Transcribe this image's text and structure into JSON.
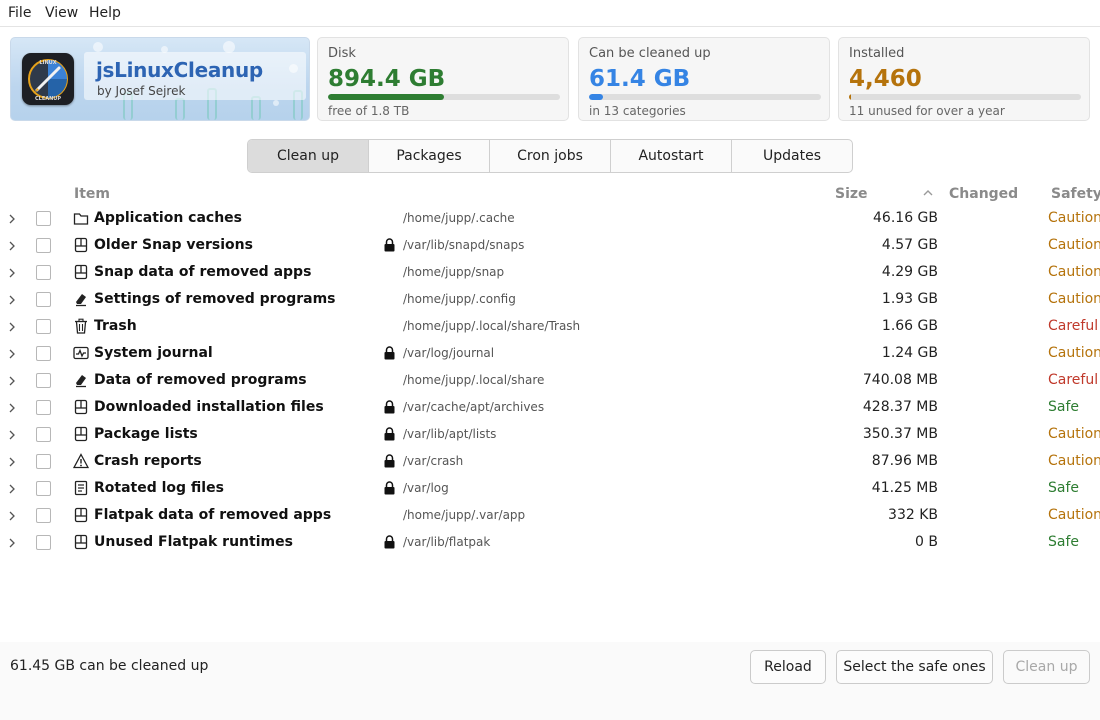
{
  "menu": [
    "File",
    "View",
    "Help"
  ],
  "app": {
    "name": "jsLinuxCleanup",
    "author": "by Josef Sejrek",
    "icon_text_top": "LINUX",
    "icon_text_bottom": "CLEANUP"
  },
  "cards": [
    {
      "title": "Disk",
      "value": "894.4 GB",
      "sub": "free of 1.8 TB",
      "color": "#2e7d32",
      "fill_fraction": 0.5
    },
    {
      "title": "Can be cleaned up",
      "value": "61.4 GB",
      "sub": "in 13 categories",
      "color": "#3584e4",
      "fill_fraction": 0.06
    },
    {
      "title": "Installed",
      "value": "4,460",
      "sub": "11 unused for over a year",
      "color": "#b5730c",
      "fill_fraction": 0.01
    }
  ],
  "tabs": [
    {
      "label": "Clean up",
      "active": true
    },
    {
      "label": "Packages",
      "active": false
    },
    {
      "label": "Cron jobs",
      "active": false
    },
    {
      "label": "Autostart",
      "active": false
    },
    {
      "label": "Updates",
      "active": false
    }
  ],
  "table": {
    "headers": {
      "item": "Item",
      "size": "Size",
      "changed": "Changed",
      "safety": "Safety"
    },
    "sort_indicator": "chevron-up-icon",
    "rows": [
      {
        "name": "Application caches",
        "icon": "folder-icon",
        "locked": false,
        "path": "/home/jupp/.cache",
        "size": "46.16 GB",
        "safety": "Caution"
      },
      {
        "name": "Older Snap versions",
        "icon": "package-icon",
        "locked": true,
        "path": "/var/lib/snapd/snaps",
        "size": "4.57 GB",
        "safety": "Caution"
      },
      {
        "name": "Snap data of removed apps",
        "icon": "package-icon",
        "locked": false,
        "path": "/home/jupp/snap",
        "size": "4.29 GB",
        "safety": "Caution"
      },
      {
        "name": "Settings of removed programs",
        "icon": "eraser-icon",
        "locked": false,
        "path": "/home/jupp/.config",
        "size": "1.93 GB",
        "safety": "Caution"
      },
      {
        "name": "Trash",
        "icon": "trash-icon",
        "locked": false,
        "path": "/home/jupp/.local/share/Trash",
        "size": "1.66 GB",
        "safety": "Careful"
      },
      {
        "name": "System journal",
        "icon": "pulse-icon",
        "locked": true,
        "path": "/var/log/journal",
        "size": "1.24 GB",
        "safety": "Caution"
      },
      {
        "name": "Data of removed programs",
        "icon": "eraser-icon",
        "locked": false,
        "path": "/home/jupp/.local/share",
        "size": "740.08 MB",
        "safety": "Careful"
      },
      {
        "name": "Downloaded installation files",
        "icon": "package-icon",
        "locked": true,
        "path": "/var/cache/apt/archives",
        "size": "428.37 MB",
        "safety": "Safe"
      },
      {
        "name": "Package lists",
        "icon": "package-icon",
        "locked": true,
        "path": "/var/lib/apt/lists",
        "size": "350.37 MB",
        "safety": "Caution"
      },
      {
        "name": "Crash reports",
        "icon": "warning-icon",
        "locked": true,
        "path": "/var/crash",
        "size": "87.96 MB",
        "safety": "Caution"
      },
      {
        "name": "Rotated log files",
        "icon": "document-icon",
        "locked": true,
        "path": "/var/log",
        "size": "41.25 MB",
        "safety": "Safe"
      },
      {
        "name": "Flatpak data of removed apps",
        "icon": "package-icon",
        "locked": false,
        "path": "/home/jupp/.var/app",
        "size": "332 KB",
        "safety": "Caution"
      },
      {
        "name": "Unused Flatpak runtimes",
        "icon": "package-icon",
        "locked": true,
        "path": "/var/lib/flatpak",
        "size": "0 B",
        "safety": "Safe"
      }
    ]
  },
  "safety_colors": {
    "Caution": "#b5730c",
    "Careful": "#c0392b",
    "Safe": "#2e7d32"
  },
  "footer": {
    "status": "61.45 GB can be cleaned up",
    "reload": "Reload",
    "select_safe": "Select the safe ones",
    "clean_up": "Clean up",
    "clean_up_enabled": false
  }
}
